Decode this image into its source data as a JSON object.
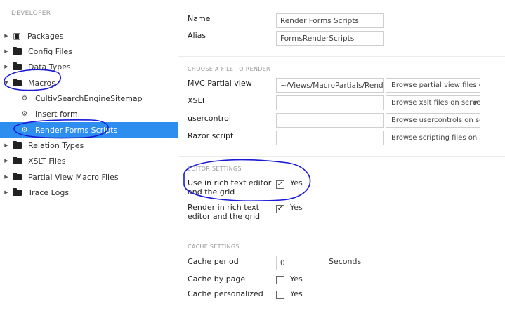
{
  "sidebar": {
    "section_title": "DEVELOPER",
    "items": [
      {
        "label": "Packages",
        "icon": "package-icon",
        "expanded": false
      },
      {
        "label": "Config Files",
        "icon": "folder-icon",
        "expanded": false
      },
      {
        "label": "Data Types",
        "icon": "folder-icon",
        "expanded": false
      },
      {
        "label": "Macros",
        "icon": "folder-icon",
        "expanded": true
      },
      {
        "label": "CultivSearchEngineSitemap",
        "icon": "gears-icon"
      },
      {
        "label": "Insert form",
        "icon": "gears-icon"
      },
      {
        "label": "Render Forms Scripts",
        "icon": "gears-icon",
        "selected": true
      },
      {
        "label": "Relation Types",
        "icon": "folder-icon",
        "expanded": false
      },
      {
        "label": "XSLT Files",
        "icon": "folder-icon",
        "expanded": false
      },
      {
        "label": "Partial View Macro Files",
        "icon": "folder-icon",
        "expanded": false
      },
      {
        "label": "Trace Logs",
        "icon": "folder-icon",
        "expanded": false
      }
    ]
  },
  "form": {
    "name_label": "Name",
    "name_value": "Render Forms Scripts",
    "alias_label": "Alias",
    "alias_value": "FormsRenderScripts",
    "file_section": "CHOOSE A FILE TO RENDER",
    "mvc_label": "MVC Partial view",
    "mvc_value": "~/Views/MacroPartials/RenderU",
    "mvc_browse": "Browse partial view files on",
    "xslt_label": "XSLT",
    "xslt_browse": "Browse xslt files on server...",
    "usercontrol_label": "usercontrol",
    "usercontrol_browse": "Browse usercontrols on ser",
    "razor_label": "Razor script",
    "razor_browse": "Browse scripting files on se",
    "editor_section": "EDITOR SETTINGS",
    "use_rte_label_1": "Use in rich text editor",
    "use_rte_label_2": "and the grid",
    "use_rte_yes": "Yes",
    "render_rte_label_1": "Render in rich text",
    "render_rte_label_2": "editor and the grid",
    "render_rte_yes": "Yes",
    "cache_section": "CACHE SETTINGS",
    "cache_period_label": "Cache period",
    "cache_period_value": "0",
    "cache_period_unit": "Seconds",
    "cache_by_page_label": "Cache by page",
    "cache_by_page_yes": "Yes",
    "cache_personalized_label": "Cache personalized",
    "cache_personalized_yes": "Yes"
  },
  "colors": {
    "selected": "#2e8ef0",
    "annotation": "#1a1ad6"
  }
}
